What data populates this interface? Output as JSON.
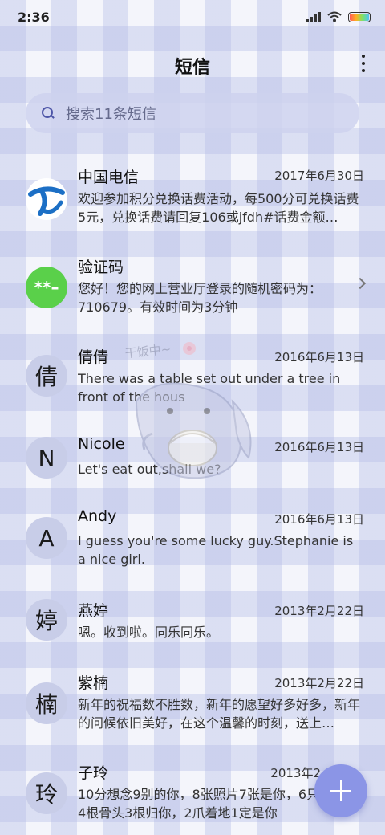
{
  "status_bar": {
    "time": "2:36"
  },
  "header": {
    "title": "短信"
  },
  "search": {
    "placeholder": "搜索11条短信"
  },
  "watermark": {
    "text": "干饭中~"
  },
  "conversations": [
    {
      "sender": "中国电信",
      "date": "2017年6月30日",
      "preview": "欢迎参加积分兑换话费活动，每500分可兑换话费5元，兑换话费请回复106或jfdh#话费金额…",
      "avatar": ""
    },
    {
      "sender": "验证码",
      "date": "",
      "preview": "您好！您的网上营业厅登录的随机密码为：710679。有效时间为3分钟",
      "avatar": "**–"
    },
    {
      "sender": "倩倩",
      "date": "2016年6月13日",
      "preview": "There was a table set out under a tree in front of the hous",
      "avatar": "倩"
    },
    {
      "sender": "Nicole",
      "date": "2016年6月13日",
      "preview": "Let's eat out,shall we?",
      "avatar": "N"
    },
    {
      "sender": "Andy",
      "date": "2016年6月13日",
      "preview": "I guess you're some lucky guy.Stephanie is a nice girl.",
      "avatar": "A"
    },
    {
      "sender": "燕婷",
      "date": "2013年2月22日",
      "preview": "嗯。收到啦。同乐同乐。",
      "avatar": "婷"
    },
    {
      "sender": "紫楠",
      "date": "2013年2月22日",
      "preview": "新年的祝福数不胜数，新年的愿望好多好多，新年的问候依旧美好，在这个温馨的时刻，送上…",
      "avatar": "楠"
    },
    {
      "sender": "子玲",
      "date": "2013年2",
      "preview": "10分想念9别的你，8张照片7张是你，6只像你，4根骨头3根归你，2爪着地1定是你",
      "avatar": "玲"
    }
  ],
  "colors": {
    "accent": "#8b95e6",
    "telecom_blue": "#1c6fc5",
    "verify_green": "#5ad04a"
  }
}
